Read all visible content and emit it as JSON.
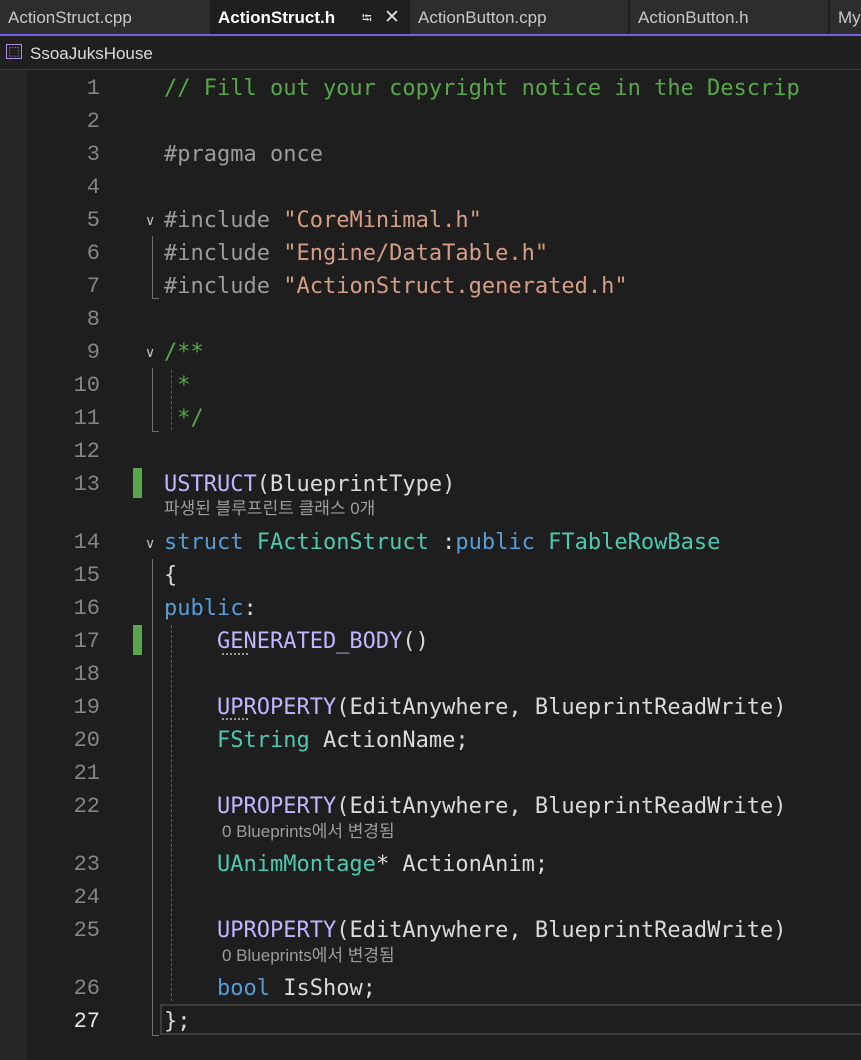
{
  "tabs": [
    {
      "label": "ActionStruct.cpp",
      "active": false
    },
    {
      "label": "ActionStruct.h",
      "active": true
    },
    {
      "label": "ActionButton.cpp",
      "active": false
    },
    {
      "label": "ActionButton.h",
      "active": false
    },
    {
      "label": "My",
      "active": false
    }
  ],
  "tab_icons": {
    "pin": "pin-icon",
    "close": "close-icon"
  },
  "scope": {
    "icon": "class-scope-icon",
    "label": "SsoaJuksHouse"
  },
  "colors": {
    "background": "#1e1e1e",
    "comment": "#57a64a",
    "keyword": "#569cd6",
    "type": "#4ec9b0",
    "string": "#d69d85",
    "macro": "#beb7ff",
    "accent": "#7160e8",
    "change_marker": "#57a64a"
  },
  "lines": [
    {
      "num": "1",
      "tokens": [
        {
          "t": "// Fill out your copyright notice in the Descrip",
          "c": "comment"
        }
      ]
    },
    {
      "num": "2",
      "tokens": []
    },
    {
      "num": "3",
      "tokens": [
        {
          "t": "#pragma once",
          "c": "pre"
        }
      ]
    },
    {
      "num": "4",
      "tokens": []
    },
    {
      "num": "5",
      "tokens": [
        {
          "t": "#include ",
          "c": "pre"
        },
        {
          "t": "\"CoreMinimal.h\"",
          "c": "str"
        }
      ]
    },
    {
      "num": "6",
      "tokens": [
        {
          "t": "#include ",
          "c": "pre"
        },
        {
          "t": "\"Engine/DataTable.h\"",
          "c": "str"
        }
      ]
    },
    {
      "num": "7",
      "tokens": [
        {
          "t": "#include ",
          "c": "pre"
        },
        {
          "t": "\"ActionStruct.generated.h\"",
          "c": "str"
        }
      ]
    },
    {
      "num": "8",
      "tokens": []
    },
    {
      "num": "9",
      "tokens": [
        {
          "t": "/**",
          "c": "comment"
        }
      ]
    },
    {
      "num": "10",
      "tokens": [
        {
          "t": " *",
          "c": "comment"
        }
      ]
    },
    {
      "num": "11",
      "tokens": [
        {
          "t": " */",
          "c": "comment"
        }
      ]
    },
    {
      "num": "12",
      "tokens": []
    },
    {
      "num": "13",
      "tokens": [
        {
          "t": "USTRUCT",
          "c": "macro"
        },
        {
          "t": "(BlueprintType)",
          "c": "plain"
        }
      ]
    },
    {
      "num": "14",
      "tokens": [
        {
          "t": "struct ",
          "c": "kw"
        },
        {
          "t": "FActionStruct",
          "c": "type"
        },
        {
          "t": " :",
          "c": "plain"
        },
        {
          "t": "public ",
          "c": "kw"
        },
        {
          "t": "FTableRowBase",
          "c": "type"
        }
      ]
    },
    {
      "num": "15",
      "tokens": [
        {
          "t": "{",
          "c": "plain"
        }
      ]
    },
    {
      "num": "16",
      "tokens": [
        {
          "t": "public",
          "c": "kw"
        },
        {
          "t": ":",
          "c": "plain"
        }
      ]
    },
    {
      "num": "17",
      "tokens": [
        {
          "t": "    ",
          "c": "plain"
        },
        {
          "t": "GENERATED_BODY",
          "c": "macro"
        },
        {
          "t": "()",
          "c": "plain"
        }
      ]
    },
    {
      "num": "18",
      "tokens": []
    },
    {
      "num": "19",
      "tokens": [
        {
          "t": "    ",
          "c": "plain"
        },
        {
          "t": "UPROPERTY",
          "c": "macro"
        },
        {
          "t": "(EditAnywhere, BlueprintReadWrite)",
          "c": "plain"
        }
      ]
    },
    {
      "num": "20",
      "tokens": [
        {
          "t": "    ",
          "c": "plain"
        },
        {
          "t": "FString",
          "c": "type"
        },
        {
          "t": " ActionName;",
          "c": "plain"
        }
      ]
    },
    {
      "num": "21",
      "tokens": []
    },
    {
      "num": "22",
      "tokens": [
        {
          "t": "    ",
          "c": "plain"
        },
        {
          "t": "UPROPERTY",
          "c": "macro"
        },
        {
          "t": "(EditAnywhere, BlueprintReadWrite)",
          "c": "plain"
        }
      ]
    },
    {
      "num": "23",
      "tokens": [
        {
          "t": "    ",
          "c": "plain"
        },
        {
          "t": "UAnimMontage",
          "c": "type"
        },
        {
          "t": "* ActionAnim;",
          "c": "plain"
        }
      ]
    },
    {
      "num": "24",
      "tokens": []
    },
    {
      "num": "25",
      "tokens": [
        {
          "t": "    ",
          "c": "plain"
        },
        {
          "t": "UPROPERTY",
          "c": "macro"
        },
        {
          "t": "(EditAnywhere, BlueprintReadWrite)",
          "c": "plain"
        }
      ]
    },
    {
      "num": "26",
      "tokens": [
        {
          "t": "    ",
          "c": "plain"
        },
        {
          "t": "bool",
          "c": "kw"
        },
        {
          "t": " IsShow;",
          "c": "plain"
        }
      ]
    },
    {
      "num": "27",
      "tokens": [
        {
          "t": "};",
          "c": "plain"
        }
      ],
      "current": true
    }
  ],
  "code_lens": [
    {
      "after_line": "13",
      "text": "파생된 블루프린트 클래스 0개"
    },
    {
      "after_line": "22",
      "text": "0 Blueprints에서 변경됨"
    },
    {
      "after_line": "25",
      "text": "0 Blueprints에서 변경됨"
    }
  ],
  "change_markers": [
    "13",
    "17"
  ],
  "fold_markers": [
    "5",
    "9",
    "14"
  ]
}
